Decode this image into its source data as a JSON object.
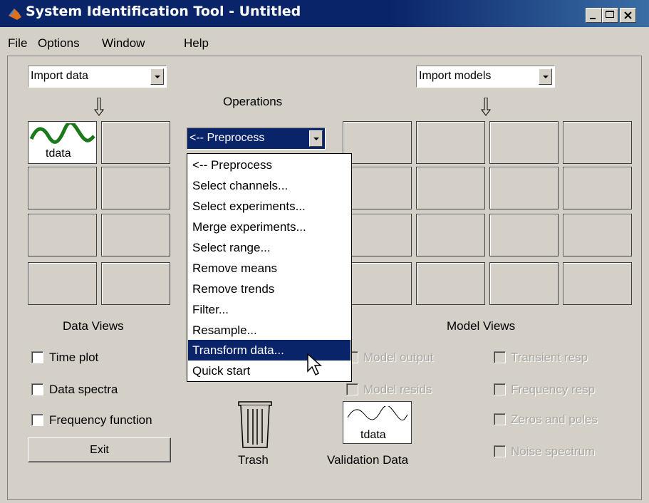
{
  "window": {
    "title": "System Identification Tool - Untitled"
  },
  "menubar": {
    "items": [
      "File",
      "Options",
      "Window",
      "Help"
    ]
  },
  "data_panel": {
    "import_combo": "Import data",
    "data_item_label": "tdata",
    "views_label": "Data Views",
    "checkboxes": [
      "Time plot",
      "Data spectra",
      "Frequency function"
    ],
    "exit_label": "Exit"
  },
  "operations": {
    "label": "Operations",
    "combo_value": "<-- Preprocess",
    "menu_items": [
      "<-- Preprocess",
      "Select channels...",
      "Select experiments...",
      "Merge experiments...",
      "Select range...",
      "Remove means",
      "Remove trends",
      "Filter...",
      "Resample...",
      "Transform data...",
      "Quick start"
    ],
    "selected_item": "Transform data..."
  },
  "model_panel": {
    "import_combo": "Import models",
    "views_label": "Model Views",
    "checkboxes_col1": [
      "Model output",
      "Model resids"
    ],
    "checkboxes_col2": [
      "Transient resp",
      "Frequency resp",
      "Zeros and poles",
      "Noise spectrum"
    ]
  },
  "trash": {
    "label": "Trash"
  },
  "validation": {
    "item_label": "tdata",
    "label": "Validation Data"
  },
  "colors": {
    "titlebar": "#0a246a",
    "data_curve": "#1a7a1a",
    "selection": "#0a246a"
  }
}
